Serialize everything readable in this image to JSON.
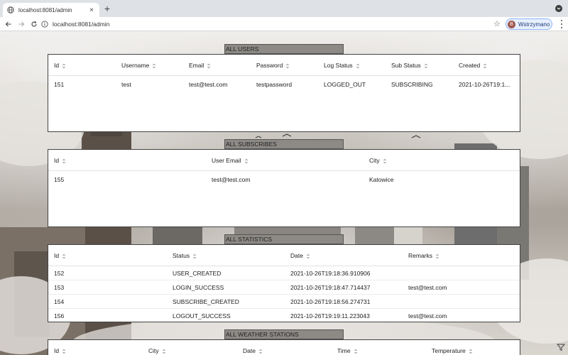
{
  "browser": {
    "tab_title": "localhost:8081/admin",
    "url": "localhost:8081/admin",
    "profile_initial": "B",
    "profile_label": "Wstrzymano"
  },
  "users": {
    "header": "ALL USERS",
    "columns": [
      "Id",
      "Username",
      "Email",
      "Password",
      "Log Status",
      "Sub Status",
      "Created"
    ],
    "rows": [
      [
        "151",
        "test",
        "test@test.com",
        "testpassword",
        "LOGGED_OUT",
        "SUBSCRIBING",
        "2021-10-26T19:1..."
      ]
    ]
  },
  "subscribes": {
    "header": "ALL SUBSCRIBES",
    "columns": [
      "Id",
      "User Email",
      "City"
    ],
    "rows": [
      [
        "155",
        "test@test.com",
        "Katowice"
      ]
    ]
  },
  "statistics": {
    "header": "ALL STATISTICS",
    "columns": [
      "Id",
      "Status",
      "Date",
      "Remarks"
    ],
    "rows": [
      [
        "152",
        "USER_CREATED",
        "2021-10-26T19:18:36.910906",
        ""
      ],
      [
        "153",
        "LOGIN_SUCCESS",
        "2021-10-26T19:18:47.714437",
        "test@test.com"
      ],
      [
        "154",
        "SUBSCRIBE_CREATED",
        "2021-10-26T19:18:56.274731",
        ""
      ],
      [
        "156",
        "LOGOUT_SUCCESS",
        "2021-10-26T19:19:11.223043",
        "test@test.com"
      ]
    ]
  },
  "weather": {
    "header": "ALL WEATHER STATIONS",
    "columns": [
      "Id",
      "City",
      "Date",
      "Time",
      "Temperature"
    ]
  }
}
